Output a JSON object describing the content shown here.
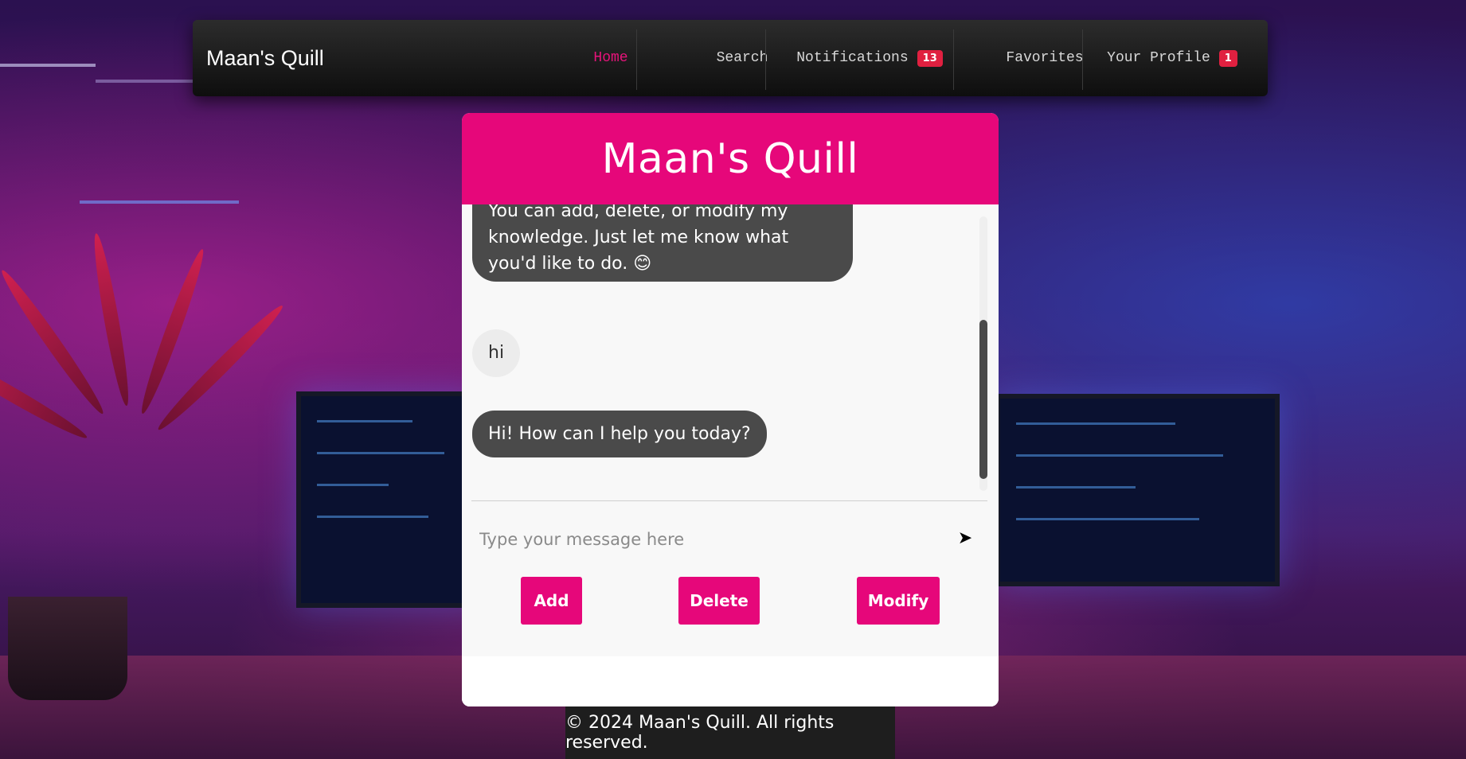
{
  "navbar": {
    "brand": "Maan's Quill",
    "items": [
      {
        "label": "Home"
      },
      {
        "label": "Search"
      },
      {
        "label": "Notifications",
        "badge": "13"
      },
      {
        "label": "Favorites"
      },
      {
        "label": "Your Profile",
        "badge": "1"
      }
    ]
  },
  "chat": {
    "title": "Maan's Quill",
    "messages": [
      {
        "role": "bot",
        "text": "You can add, delete, or modify my knowledge. Just let me know what you'd like to do. 😊"
      },
      {
        "role": "user",
        "text": "hi"
      },
      {
        "role": "bot",
        "text": "Hi! How can I help you today?"
      }
    ],
    "input_placeholder": "Type your message here",
    "send_icon": "➤",
    "buttons": {
      "add": "Add",
      "delete": "Delete",
      "modify": "Modify"
    }
  },
  "footer": {
    "text": "© 2024 Maan's Quill. All rights reserved."
  },
  "colors": {
    "accent": "#e6077a",
    "badge": "#e02040",
    "bot_bubble": "#4a4a4a",
    "nav_active": "#e6137a"
  }
}
